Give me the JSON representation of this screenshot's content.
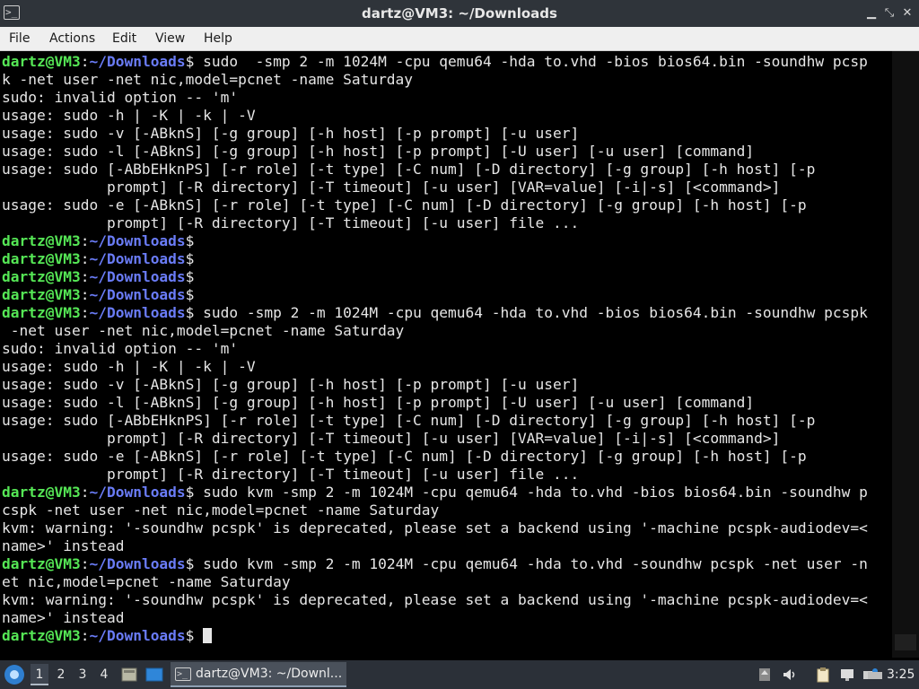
{
  "window": {
    "title": "dartz@VM3: ~/Downloads",
    "icons": {
      "app": "terminal-icon",
      "minimize": "minimize-icon",
      "maximize": "maximize-icon",
      "close": "close-icon"
    }
  },
  "menu": {
    "file": "File",
    "actions": "Actions",
    "edit": "Edit",
    "view": "View",
    "help": "Help"
  },
  "prompt": {
    "user": "dartz@VM3",
    "colon": ":",
    "path": "~/Downloads",
    "dollar": "$"
  },
  "terminal": {
    "lines": [
      {
        "type": "prompt",
        "text": " sudo  -smp 2 -m 1024M -cpu qemu64 -hda to.vhd -bios bios64.bin -soundhw pcsp"
      },
      {
        "type": "out",
        "text": "k -net user -net nic,model=pcnet -name Saturday"
      },
      {
        "type": "out",
        "text": "sudo: invalid option -- 'm'"
      },
      {
        "type": "out",
        "text": "usage: sudo -h | -K | -k | -V"
      },
      {
        "type": "out",
        "text": "usage: sudo -v [-ABknS] [-g group] [-h host] [-p prompt] [-u user]"
      },
      {
        "type": "out",
        "text": "usage: sudo -l [-ABknS] [-g group] [-h host] [-p prompt] [-U user] [-u user] [command]"
      },
      {
        "type": "out",
        "text": "usage: sudo [-ABbEHknPS] [-r role] [-t type] [-C num] [-D directory] [-g group] [-h host] [-p"
      },
      {
        "type": "out",
        "text": "            prompt] [-R directory] [-T timeout] [-u user] [VAR=value] [-i|-s] [<command>]"
      },
      {
        "type": "out",
        "text": "usage: sudo -e [-ABknS] [-r role] [-t type] [-C num] [-D directory] [-g group] [-h host] [-p"
      },
      {
        "type": "out",
        "text": "            prompt] [-R directory] [-T timeout] [-u user] file ..."
      },
      {
        "type": "prompt",
        "text": ""
      },
      {
        "type": "prompt",
        "text": ""
      },
      {
        "type": "prompt",
        "text": ""
      },
      {
        "type": "prompt",
        "text": ""
      },
      {
        "type": "prompt",
        "text": " sudo -smp 2 -m 1024M -cpu qemu64 -hda to.vhd -bios bios64.bin -soundhw pcspk"
      },
      {
        "type": "out",
        "text": " -net user -net nic,model=pcnet -name Saturday"
      },
      {
        "type": "out",
        "text": "sudo: invalid option -- 'm'"
      },
      {
        "type": "out",
        "text": "usage: sudo -h | -K | -k | -V"
      },
      {
        "type": "out",
        "text": "usage: sudo -v [-ABknS] [-g group] [-h host] [-p prompt] [-u user]"
      },
      {
        "type": "out",
        "text": "usage: sudo -l [-ABknS] [-g group] [-h host] [-p prompt] [-U user] [-u user] [command]"
      },
      {
        "type": "out",
        "text": "usage: sudo [-ABbEHknPS] [-r role] [-t type] [-C num] [-D directory] [-g group] [-h host] [-p"
      },
      {
        "type": "out",
        "text": "            prompt] [-R directory] [-T timeout] [-u user] [VAR=value] [-i|-s] [<command>]"
      },
      {
        "type": "out",
        "text": "usage: sudo -e [-ABknS] [-r role] [-t type] [-C num] [-D directory] [-g group] [-h host] [-p"
      },
      {
        "type": "out",
        "text": "            prompt] [-R directory] [-T timeout] [-u user] file ..."
      },
      {
        "type": "prompt",
        "text": " sudo kvm -smp 2 -m 1024M -cpu qemu64 -hda to.vhd -bios bios64.bin -soundhw p"
      },
      {
        "type": "out",
        "text": "cspk -net user -net nic,model=pcnet -name Saturday"
      },
      {
        "type": "out",
        "text": "kvm: warning: '-soundhw pcspk' is deprecated, please set a backend using '-machine pcspk-audiodev=<"
      },
      {
        "type": "out",
        "text": "name>' instead"
      },
      {
        "type": "prompt",
        "text": " sudo kvm -smp 2 -m 1024M -cpu qemu64 -hda to.vhd -soundhw pcspk -net user -n"
      },
      {
        "type": "out",
        "text": "et nic,model=pcnet -name Saturday"
      },
      {
        "type": "out",
        "text": "kvm: warning: '-soundhw pcspk' is deprecated, please set a backend using '-machine pcspk-audiodev=<"
      },
      {
        "type": "out",
        "text": "name>' instead"
      },
      {
        "type": "prompt",
        "text": " ",
        "cursor": true
      }
    ]
  },
  "colors": {
    "prompt_user": "#55e655",
    "prompt_path": "#6a7cf7",
    "text": "#e6e6e6",
    "background": "#000000",
    "titlebar": "#2f343a",
    "taskbar": "#2b3038"
  },
  "taskbar": {
    "start_icon": "start-menu-icon",
    "workspaces": [
      "1",
      "2",
      "3",
      "4"
    ],
    "active_workspace": "1",
    "quicklaunch": [
      "show-desktop-icon",
      "desktop-icon"
    ],
    "task": {
      "icon": "terminal-icon",
      "label": "dartz@VM3: ~/Downl..."
    },
    "tray": [
      "eject-icon",
      "volume-icon",
      "clipboard-icon",
      "display-icon",
      "network-icon",
      "keyboard-icon"
    ],
    "clock": "3:25"
  }
}
